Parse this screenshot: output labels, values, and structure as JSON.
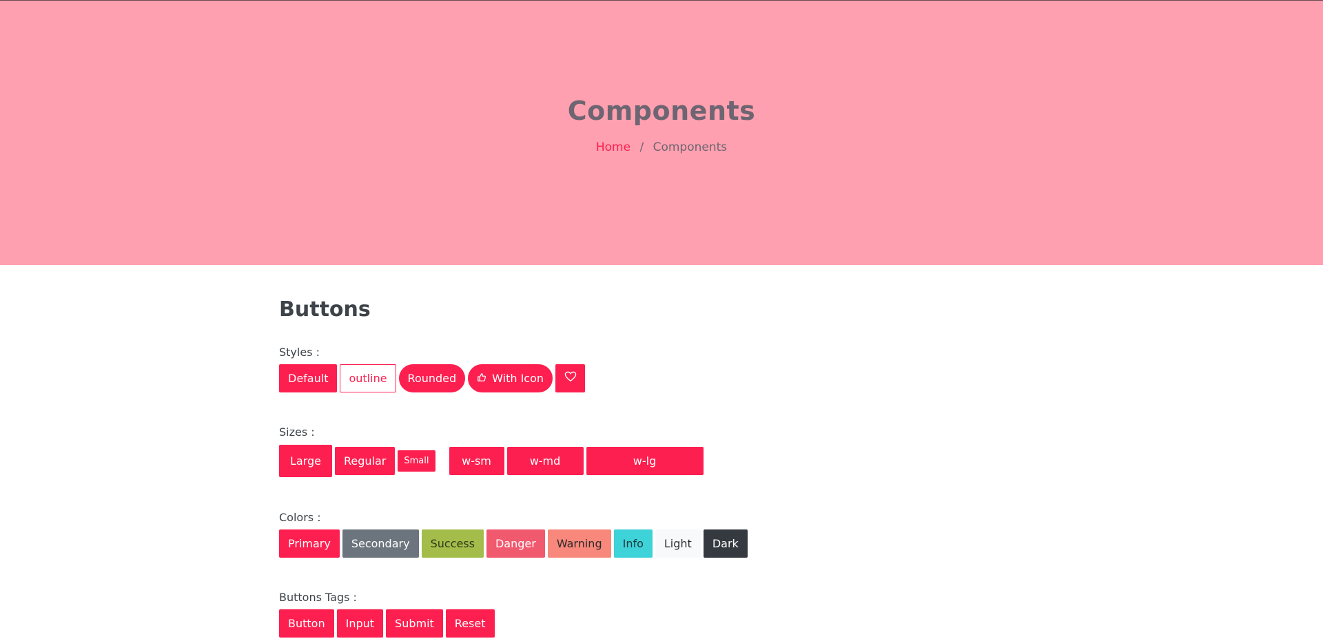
{
  "hero": {
    "title": "Components",
    "breadcrumb": {
      "home": "Home",
      "separator": "/",
      "current": "Components"
    }
  },
  "section": {
    "title": "Buttons"
  },
  "styles": {
    "label": "Styles :",
    "buttons": {
      "default": "Default",
      "outline": "outline",
      "rounded": "Rounded",
      "with_icon": "With Icon"
    },
    "icons": {
      "with_icon": "thumbs-up-icon",
      "heart": "heart-icon"
    }
  },
  "sizes": {
    "label": "Sizes :",
    "buttons": {
      "large": "Large",
      "regular": "Regular",
      "small": "Small",
      "w_sm": "w-sm",
      "w_md": "w-md",
      "w_lg": "w-lg"
    }
  },
  "colors": {
    "label": "Colors :",
    "buttons": {
      "primary": "Primary",
      "secondary": "Secondary",
      "success": "Success",
      "danger": "Danger",
      "warning": "Warning",
      "info": "Info",
      "light": "Light",
      "dark": "Dark"
    },
    "palette": {
      "primary": "#fd1f4f",
      "secondary": "#6c757d",
      "success": "#a3bc4a",
      "danger": "#f0596e",
      "warning": "#f7887b",
      "info": "#3ed2d9",
      "light": "#f8f9fa",
      "dark": "#343a40",
      "hero_bg": "#fea0b0"
    }
  },
  "tags": {
    "label": "Buttons Tags :",
    "buttons": {
      "button": "Button",
      "input": "Input",
      "submit": "Submit",
      "reset": "Reset"
    }
  }
}
